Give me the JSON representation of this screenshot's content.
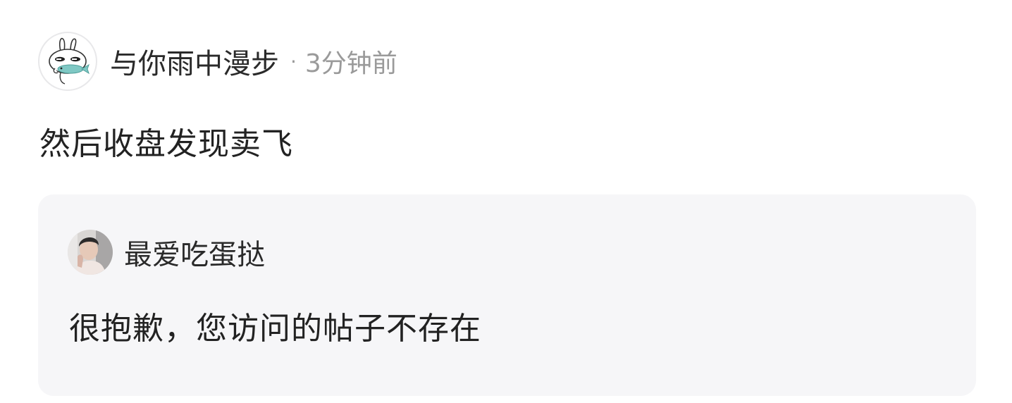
{
  "post": {
    "author": {
      "name": "与你雨中漫步",
      "avatar_icon": "bunny-with-fish-avatar"
    },
    "separator": "·",
    "timestamp": "3分钟前",
    "content": "然后收盘发现卖飞"
  },
  "quoted_post": {
    "author": {
      "name": "最爱吃蛋挞",
      "avatar_icon": "person-photo-avatar"
    },
    "content": "很抱歉，您访问的帖子不存在"
  },
  "colors": {
    "text_primary": "#222222",
    "text_secondary": "#9a9a9a",
    "quote_background": "#f6f6f8",
    "fish_accent": "#7fc8c4"
  }
}
